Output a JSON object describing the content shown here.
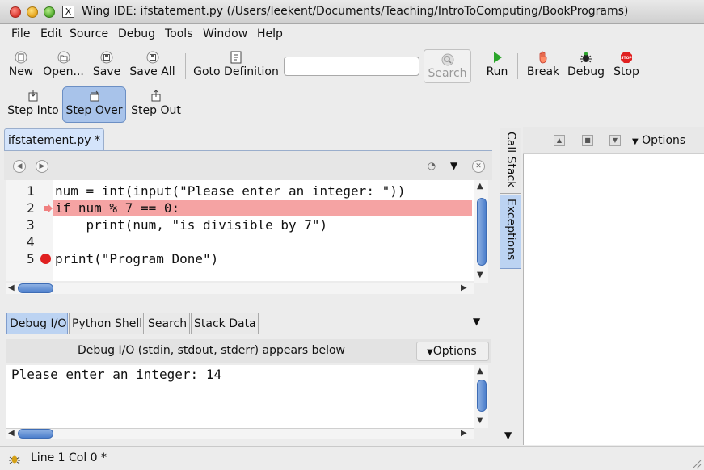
{
  "window": {
    "title": "Wing IDE: ifstatement.py (/Users/leekent/Documents/Teaching/IntroToComputing/BookPrograms)",
    "x11_glyph": "X"
  },
  "menu": [
    "File",
    "Edit",
    "Source",
    "Debug",
    "Tools",
    "Window",
    "Help"
  ],
  "toolbar": {
    "new": "New",
    "open": "Open...",
    "save": "Save",
    "save_all": "Save All",
    "goto_definition": "Goto Definition",
    "search_placeholder": "",
    "search": "Search",
    "run": "Run",
    "break": "Break",
    "debug": "Debug",
    "stop": "Stop",
    "stop_icon_text": "STOP",
    "step_into": "Step Into",
    "step_over": "Step Over",
    "step_out": "Step Out"
  },
  "editor": {
    "tab_label": "ifstatement.py *",
    "lines": [
      {
        "num": "1",
        "text": "num = int(input(\"Please enter an integer: \"))"
      },
      {
        "num": "2",
        "text": "if num % 7 == 0:"
      },
      {
        "num": "3",
        "text": "    print(num, \"is divisible by 7\")"
      },
      {
        "num": "4",
        "text": ""
      },
      {
        "num": "5",
        "text": "print(\"Program Done\")"
      }
    ],
    "current_line": 2,
    "breakpoint_line": 5
  },
  "bottom_panel": {
    "tabs": [
      "Debug I/O",
      "Python Shell",
      "Search",
      "Stack Data"
    ],
    "header": "Debug I/O (stdin, stdout, stderr) appears below",
    "options": "Options",
    "output": "Please enter an integer: 14"
  },
  "right_panel": {
    "tabs": [
      "Call Stack",
      "Exceptions"
    ],
    "options": "Options"
  },
  "status": {
    "text": "Line 1 Col 0 *"
  },
  "colors": {
    "current_line_bg": "#f5a3a3",
    "active_tab_bg": "#bcd3f2",
    "keyword": "#2a1ea0",
    "string": "#6c1f8f",
    "breakpoint": "#e02020"
  }
}
